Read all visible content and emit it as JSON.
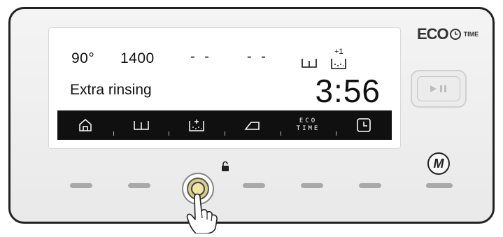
{
  "display": {
    "temperature": "90°",
    "spin_speed": "1400",
    "dash_1": "- -",
    "dash_2": "- -",
    "extra_rinse_badge": "+1",
    "program": "Extra rinsing",
    "remaining_time": "3:56"
  },
  "menu": {
    "items": [
      {
        "icon": "home-icon"
      },
      {
        "icon": "rinse-basin-icon"
      },
      {
        "icon": "extra-rinse-icon"
      },
      {
        "icon": "iron-icon"
      },
      {
        "icon": "eco-time-icon",
        "line1": "ECO",
        "line2": "TIME"
      },
      {
        "icon": "delay-timer-icon"
      }
    ]
  },
  "brand": {
    "logo": "ECO",
    "logo_suffix": "TIME"
  },
  "controls": {
    "memory_button": "M",
    "start_pause_icon": "play-pause-icon",
    "lock_icon": "padlock-icon",
    "pressed_key_index": 3
  }
}
